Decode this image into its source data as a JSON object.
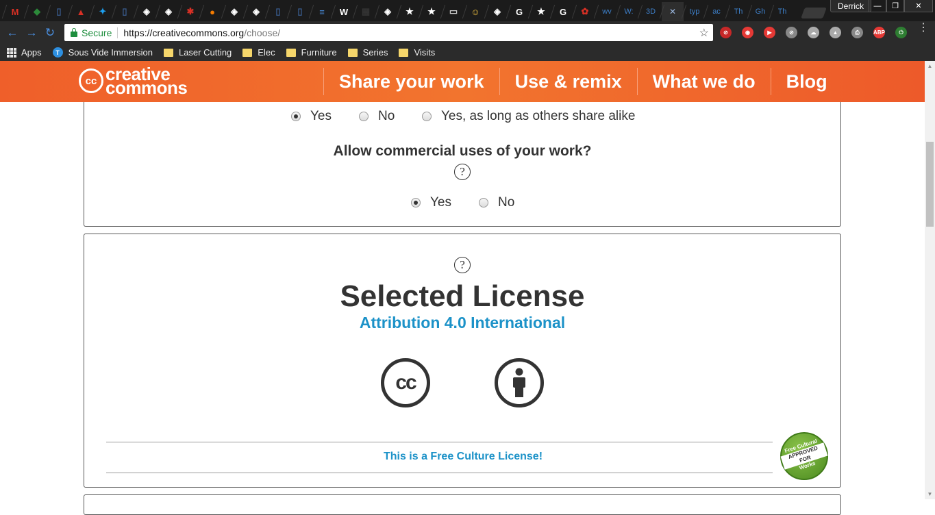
{
  "browser": {
    "tabs": [
      {
        "icon": "gmail-icon",
        "color": "#d93025",
        "glyph": "M"
      },
      {
        "icon": "extension-green-icon",
        "color": "#2c8a3a",
        "glyph": "◆"
      },
      {
        "icon": "doc-icon",
        "color": "#3a5d8f",
        "glyph": "▯"
      },
      {
        "icon": "photo-icon",
        "color": "#d93025",
        "glyph": "▲"
      },
      {
        "icon": "twitter-icon",
        "color": "#1da1f2",
        "glyph": "✦"
      },
      {
        "icon": "doc-icon",
        "color": "#3a5d8f",
        "glyph": "▯"
      },
      {
        "icon": "cc-icon",
        "color": "#ffffff",
        "glyph": "◈"
      },
      {
        "icon": "cc-icon",
        "color": "#ffffff",
        "glyph": "◈"
      },
      {
        "icon": "snowflake-icon",
        "color": "#d93025",
        "glyph": "✱"
      },
      {
        "icon": "orange-circle-icon",
        "color": "#f57c00",
        "glyph": "●"
      },
      {
        "icon": "cc-icon",
        "color": "#ffffff",
        "glyph": "◈"
      },
      {
        "icon": "cc-icon",
        "color": "#ffffff",
        "glyph": "◈"
      },
      {
        "icon": "doc-icon",
        "color": "#3a5d8f",
        "glyph": "▯"
      },
      {
        "icon": "doc-icon",
        "color": "#3a5d8f",
        "glyph": "▯"
      },
      {
        "icon": "lines-icon",
        "color": "#4a8fe0",
        "glyph": "≡"
      },
      {
        "icon": "wikipedia-icon",
        "color": "#ffffff",
        "glyph": "W"
      },
      {
        "icon": "grid-icon",
        "color": "#333333",
        "glyph": "▦"
      },
      {
        "icon": "cc-icon",
        "color": "#ffffff",
        "glyph": "◈"
      },
      {
        "icon": "star-icon",
        "color": "#ffffff",
        "glyph": "★"
      },
      {
        "icon": "star-icon",
        "color": "#ffffff",
        "glyph": "★"
      },
      {
        "icon": "image-icon",
        "color": "#cccccc",
        "glyph": "▭"
      },
      {
        "icon": "person-icon",
        "color": "#f5c542",
        "glyph": "☺"
      },
      {
        "icon": "cc-icon",
        "color": "#ffffff",
        "glyph": "◈"
      },
      {
        "icon": "google-icon",
        "color": "#ffffff",
        "glyph": "G"
      },
      {
        "icon": "star-icon",
        "color": "#ffffff",
        "glyph": "★"
      },
      {
        "icon": "google-icon",
        "color": "#ffffff",
        "glyph": "G"
      },
      {
        "icon": "popcorn-icon",
        "color": "#d93025",
        "glyph": "✿"
      }
    ],
    "text_tabs": [
      "wv",
      "W:",
      "3D",
      "",
      "typ",
      "ac",
      "Th",
      "Gh",
      "Th"
    ],
    "profile_name": "Derrick",
    "window_min": "—",
    "window_max": "❐",
    "window_close": "✕",
    "back": "←",
    "forward": "→",
    "reload": "↻",
    "secure_label": "Secure",
    "url_host": "https://creativecommons.org",
    "url_path": "/choose/",
    "bookmark_star": "☆",
    "menu": "⋮",
    "bookmarks": {
      "apps": "Apps",
      "items": [
        "Sous Vide Immersion",
        "Laser Cutting",
        "Elec",
        "Furniture",
        "Series",
        "Visits"
      ]
    },
    "extensions": [
      {
        "icon": "no-icon",
        "color": "#c62828",
        "glyph": "⊘"
      },
      {
        "icon": "shield-icon",
        "color": "#e53935",
        "glyph": "◉"
      },
      {
        "icon": "youtube-icon",
        "color": "#e53935",
        "glyph": "▶"
      },
      {
        "icon": "no-icon",
        "color": "#888888",
        "glyph": "⊘"
      },
      {
        "icon": "cloud-icon",
        "color": "#aaaaaa",
        "glyph": "☁"
      },
      {
        "icon": "drive-icon",
        "color": "#aaaaaa",
        "glyph": "▲"
      },
      {
        "icon": "pdf-icon",
        "color": "#888888",
        "glyph": "⎙"
      },
      {
        "icon": "adblock-icon",
        "color": "#e53935",
        "glyph": "ABP"
      },
      {
        "icon": "power-icon",
        "color": "#2e7d32",
        "glyph": "⏻"
      }
    ]
  },
  "site": {
    "logo_mark": "cc",
    "logo_line1": "creative",
    "logo_line2": "commons",
    "nav": [
      "Share your work",
      "Use & remix",
      "What we do",
      "Blog"
    ]
  },
  "form": {
    "share_options": [
      "Yes",
      "No",
      "Yes, as long as others share alike"
    ],
    "share_selected": "Yes",
    "commercial_question": "Allow commercial uses of your work?",
    "commercial_options": [
      "Yes",
      "No"
    ],
    "commercial_selected": "Yes",
    "help_glyph": "?"
  },
  "license": {
    "title": "Selected License",
    "name": "Attribution 4.0 International",
    "cc_letters": "cc",
    "free_culture": "This is a Free Culture License!",
    "badge": {
      "line1": "Free Cultural",
      "line2": "APPROVED FOR",
      "line3": "Works"
    },
    "accent_color": "#1c92c8"
  }
}
